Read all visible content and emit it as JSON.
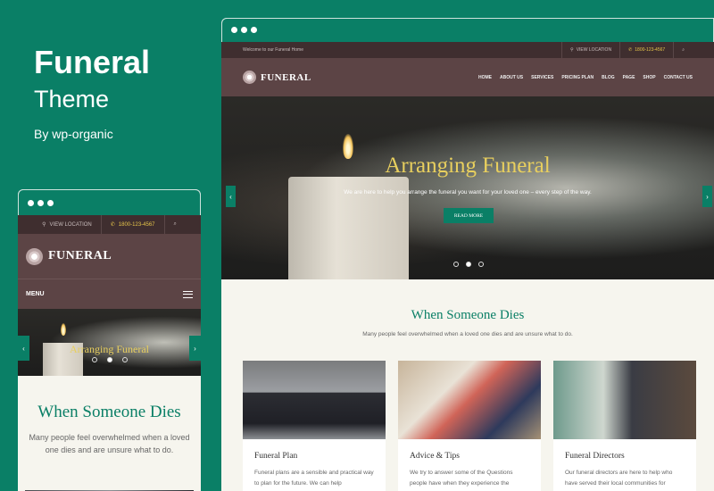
{
  "brand": {
    "title": "Funeral",
    "subtitle": "Theme",
    "byline": "By wp-organic"
  },
  "desktop": {
    "topbar": {
      "welcome": "Welcome to our Funeral Home",
      "location": "VIEW LOCATION",
      "phone": "1800-123-4567"
    },
    "logo": "FUNERAL",
    "nav": [
      "HOME",
      "ABOUT US",
      "SERVICES",
      "PRICING PLAN",
      "BLOG",
      "PAGE",
      "SHOP",
      "CONTACT US"
    ],
    "hero": {
      "title": "Arranging Funeral",
      "subtitle": "We are here to help you arrange the funeral you want for your loved one – every step of the way.",
      "button": "READ MORE"
    },
    "section": {
      "title": "When Someone Dies",
      "subtitle": "Many people feel overwhelmed when a loved one dies and are unsure what to do.",
      "cards": [
        {
          "title": "Funeral Plan",
          "text": "Funeral plans are a sensible and practical way to plan for the future. We can help"
        },
        {
          "title": "Advice & Tips",
          "text": "We try to answer some of the Questions people have when they experience the"
        },
        {
          "title": "Funeral Directors",
          "text": "Our funeral directors are here to help who have served their local communities for"
        }
      ]
    }
  },
  "mobile": {
    "location": "VIEW LOCATION",
    "phone": "1800-123-4567",
    "logo": "FUNERAL",
    "menu": "MENU",
    "hero_title": "Arranging Funeral",
    "section_title": "When Someone Dies",
    "section_subtitle": "Many people feel overwhelmed when a loved one dies and are unsure what to do."
  },
  "colors": {
    "accent": "#0a7f66",
    "header": "#5c4445",
    "topbar": "#3f2e2f",
    "gold": "#e8cf5e"
  },
  "icons": {
    "location": "map-pin-icon",
    "phone": "phone-icon",
    "search": "search-icon",
    "chevron": "chevron-icon",
    "menu": "hamburger-icon"
  }
}
